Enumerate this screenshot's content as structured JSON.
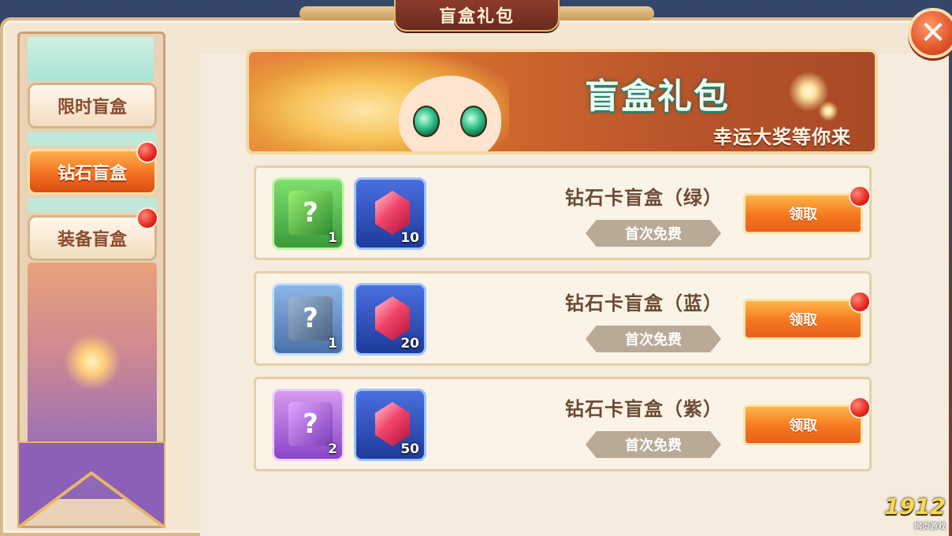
{
  "window": {
    "title": "盲盒礼包"
  },
  "sidebar": {
    "tabs": [
      {
        "label": "限时盲盒",
        "active": false,
        "badge": false
      },
      {
        "label": "钻石盲盒",
        "active": true,
        "badge": true
      },
      {
        "label": "装备盲盒",
        "active": false,
        "badge": true
      }
    ]
  },
  "banner": {
    "title": "盲盒礼包",
    "subtitle": "幸运大奖等你来"
  },
  "rewards": [
    {
      "name": "钻石卡盲盒（绿）",
      "tag": "首次免费",
      "button": "领取",
      "items": [
        {
          "icon": "green-mystery-box-icon",
          "qty": "1"
        },
        {
          "icon": "red-gem-icon",
          "qty": "10"
        }
      ]
    },
    {
      "name": "钻石卡盲盒（蓝）",
      "tag": "首次免费",
      "button": "领取",
      "items": [
        {
          "icon": "blue-mystery-box-icon",
          "qty": "1"
        },
        {
          "icon": "red-gem-icon",
          "qty": "20"
        }
      ]
    },
    {
      "name": "钻石卡盲盒（紫）",
      "tag": "首次免费",
      "button": "领取",
      "items": [
        {
          "icon": "purple-mystery-box-icon",
          "qty": "2"
        },
        {
          "icon": "red-gem-icon",
          "qty": "50"
        }
      ]
    }
  ],
  "watermark": {
    "text": "1912",
    "sub": "网页游戏"
  },
  "colors": {
    "accent_orange": "#f5771e",
    "badge_red": "#e5251c",
    "title_bar": "#8c3a2a"
  }
}
